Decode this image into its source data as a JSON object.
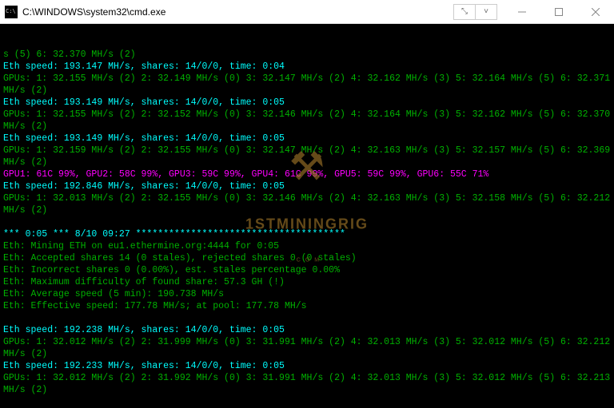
{
  "window": {
    "title": "C:\\WINDOWS\\system32\\cmd.exe"
  },
  "watermark": {
    "main": "1STMININGRIG",
    "sub": ".COM"
  },
  "lines": [
    {
      "cls": "",
      "t": "s (5) 6: 32.370 MH/s (2)"
    },
    {
      "cls": "cyan",
      "t": "Eth speed: 193.147 MH/s, shares: 14/0/0, time: 0:04"
    },
    {
      "cls": "",
      "t": "GPUs: 1: 32.155 MH/s (2) 2: 32.149 MH/s (0) 3: 32.147 MH/s (2) 4: 32.162 MH/s (3) 5: 32.164 MH/s (5) 6: 32.371 MH/s (2)"
    },
    {
      "cls": "cyan",
      "t": "Eth speed: 193.149 MH/s, shares: 14/0/0, time: 0:05"
    },
    {
      "cls": "",
      "t": "GPUs: 1: 32.155 MH/s (2) 2: 32.152 MH/s (0) 3: 32.146 MH/s (2) 4: 32.164 MH/s (3) 5: 32.162 MH/s (5) 6: 32.370 MH/s (2)"
    },
    {
      "cls": "cyan",
      "t": "Eth speed: 193.149 MH/s, shares: 14/0/0, time: 0:05"
    },
    {
      "cls": "",
      "t": "GPUs: 1: 32.159 MH/s (2) 2: 32.155 MH/s (0) 3: 32.147 MH/s (2) 4: 32.163 MH/s (3) 5: 32.157 MH/s (5) 6: 32.369 MH/s (2)"
    },
    {
      "cls": "mag",
      "t": "GPU1: 61C 99%, GPU2: 58C 99%, GPU3: 59C 99%, GPU4: 61C 99%, GPU5: 59C 99%, GPU6: 55C 71%"
    },
    {
      "cls": "cyan",
      "t": "Eth speed: 192.846 MH/s, shares: 14/0/0, time: 0:05"
    },
    {
      "cls": "",
      "t": "GPUs: 1: 32.013 MH/s (2) 2: 32.155 MH/s (0) 3: 32.146 MH/s (2) 4: 32.163 MH/s (3) 5: 32.158 MH/s (5) 6: 32.212 MH/s (2)"
    },
    {
      "cls": "",
      "t": ""
    },
    {
      "cls": "cyan",
      "t": "*** 0:05 *** 8/10 09:27 **************************************"
    },
    {
      "cls": "",
      "t": "Eth: Mining ETH on eu1.ethermine.org:4444 for 0:05"
    },
    {
      "cls": "",
      "t": "Eth: Accepted shares 14 (0 stales), rejected shares 0 (0 stales)"
    },
    {
      "cls": "",
      "t": "Eth: Incorrect shares 0 (0.00%), est. stales percentage 0.00%"
    },
    {
      "cls": "",
      "t": "Eth: Maximum difficulty of found share: 57.3 GH (!)"
    },
    {
      "cls": "",
      "t": "Eth: Average speed (5 min): 190.738 MH/s"
    },
    {
      "cls": "",
      "t": "Eth: Effective speed: 177.78 MH/s; at pool: 177.78 MH/s"
    },
    {
      "cls": "",
      "t": ""
    },
    {
      "cls": "cyan",
      "t": "Eth speed: 192.238 MH/s, shares: 14/0/0, time: 0:05"
    },
    {
      "cls": "",
      "t": "GPUs: 1: 32.012 MH/s (2) 2: 31.999 MH/s (0) 3: 31.991 MH/s (2) 4: 32.013 MH/s (3) 5: 32.012 MH/s (5) 6: 32.212 MH/s (2)"
    },
    {
      "cls": "cyan",
      "t": "Eth speed: 192.233 MH/s, shares: 14/0/0, time: 0:05"
    },
    {
      "cls": "",
      "t": "GPUs: 1: 32.012 MH/s (2) 2: 31.992 MH/s (0) 3: 31.991 MH/s (2) 4: 32.013 MH/s (3) 5: 32.012 MH/s (5) 6: 32.213 MH/s (2)"
    }
  ]
}
